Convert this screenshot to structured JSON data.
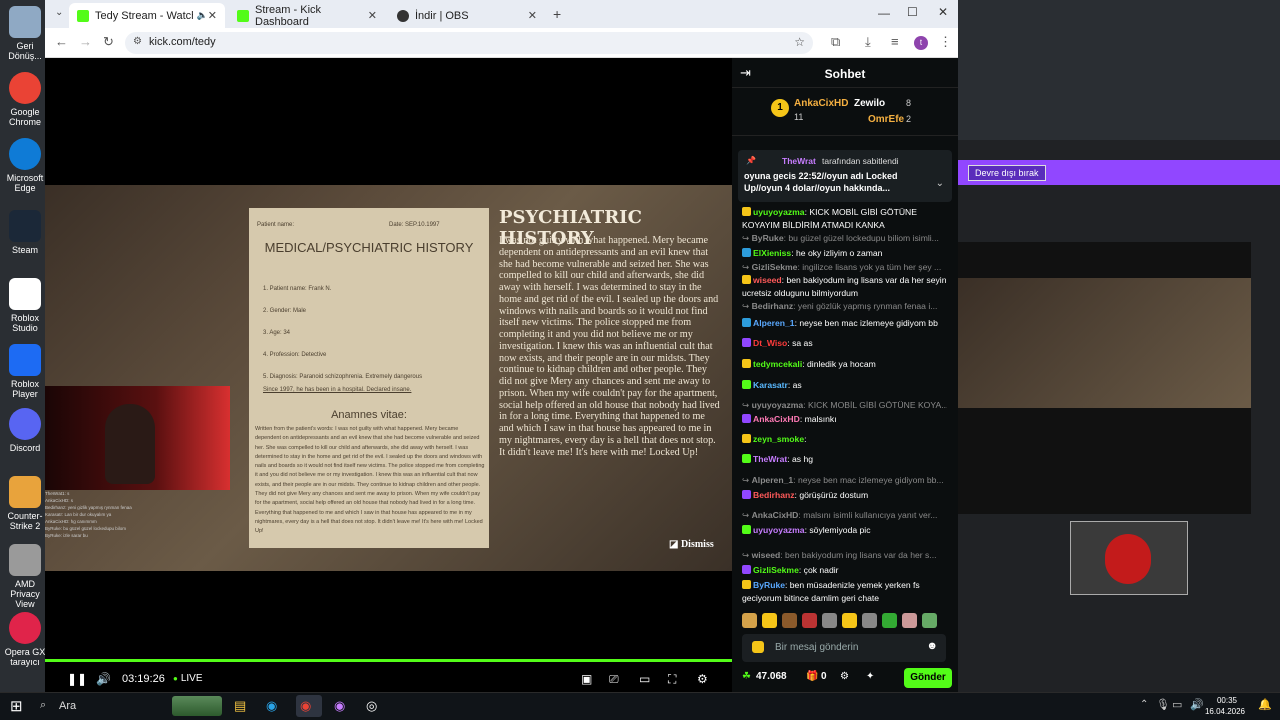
{
  "desktop": {
    "icons": [
      {
        "label": "Geri Dönüş...",
        "icon": "recycle-bin-icon"
      },
      {
        "label": "Google Chrome",
        "icon": "chrome-icon"
      },
      {
        "label": "Microsoft Edge",
        "icon": "edge-icon"
      },
      {
        "label": "Steam",
        "icon": "steam-icon"
      },
      {
        "label": "Roblox Studio",
        "icon": "roblox-studio-icon"
      },
      {
        "label": "Roblox Player",
        "icon": "roblox-player-icon"
      },
      {
        "label": "Discord",
        "icon": "discord-icon"
      },
      {
        "label": "Counter-Strike 2",
        "icon": "cs2-icon"
      },
      {
        "label": "AMD Privacy View",
        "icon": "amd-icon"
      },
      {
        "label": "Opera GX tarayıcı",
        "icon": "opera-gx-icon"
      }
    ]
  },
  "browser": {
    "tabs": [
      {
        "title": "Tedy Stream - Watch Live o",
        "favicon": "kick-icon"
      },
      {
        "title": "Stream - Kick Dashboard",
        "favicon": "kick-icon"
      },
      {
        "title": "İndir | OBS",
        "favicon": "obs-icon"
      }
    ],
    "url": "kick.com/tedy",
    "profile_initial": "t"
  },
  "game": {
    "paper": {
      "patient_name_label": "Patient name:",
      "date": "Date: SEP.10.1997",
      "title": "MEDICAL/PSYCHIATRIC HISTORY",
      "fields": [
        "1. Patient name: Frank N.",
        "2. Gender: Male",
        "3. Age: 34",
        "4. Profession: Detective",
        "5. Diagnosis: Paranoid schizophrenia.  Extremely dangerous"
      ],
      "since": "Since 1997, he has been in a hospital. Declared insane.",
      "anamnes": "Anamnes vitae:",
      "written": "Written from the patient's words: I was not guilty with what happened. Mery became dependent on antidepressants and an evil knew that she had become vulnerable and seized her. She was compelled to kill our child and afterwards, she did away with herself. I was determined to stay in the home and get rid of the evil. I sealed up the doors and windows with nails and boards so it would not find itself new victims. The police stopped me from completing it and you did not believe me or my investigation. I knew this was an influential cult that now exists, and their people are in our midsts. They continue to kidnap children and other people. They did not give Mery any chances and sent me away to prison. When my wife couldn't pay for the apartment, social help offered an old house that nobody had lived in for a long time. Everything that happened to me and which I saw in that house has appeared to me in my nightmares, every day is a hell that does not stop. It didn't leave me! It's here with me! Locked Up!"
    },
    "heading": "PSYCHIATRIC HISTORY",
    "text": "I was not guilty with what happened. Mery became dependent on antidepressants and an evil knew that she had become vulnerable and seized her. She was compelled to kill our child and afterwards, she did away with herself. I was determined to stay in the home and get rid of the evil. I sealed up the doors and windows with nails and boards so it would not find itself new victims. The police stopped me from completing it and you did not believe me or my investigation. I knew this was an influential cult that now exists, and their people are in our midsts. They continue to kidnap children and other people. They did not give Mery any chances and sent me away to prison. When my wife couldn't pay for the apartment, social help offered an old house that nobody had lived in for a long time. Everything that happened to me and which I saw in that house has appeared to me in my nightmares, every day is a hell that does not stop. It didn't leave me! It's here with me! Locked Up!",
    "dismiss": "Dismiss",
    "overlay_chat": [
      "TheWrat1: s",
      "AnkaCixHD: s",
      "Bedirhanz: yeni gizlik yapmış rynman fenaa",
      "Karasatr: Lan bir dur okuyalım ya",
      "AnkaCixHD: hg canımmm",
      "ByRuke: bu güzel güzel lockedupu bilom",
      "ByRuke: izle sarar bu"
    ]
  },
  "player": {
    "progress": 1.0,
    "time": "03:19:26",
    "live": "LIVE"
  },
  "chat": {
    "title": "Sohbet",
    "leaderboard": [
      {
        "rank": "1",
        "name": "AnkaCixHD",
        "count": "11",
        "color": "#f5b041"
      },
      {
        "name": "Zewilo",
        "count": "8",
        "color": "#ffffff"
      },
      {
        "name": "OmrEfe",
        "count": "2",
        "color": "#f5b041"
      }
    ],
    "pinned": {
      "by_user": "TheWrat",
      "by_suffix": "tarafından sabitlendi",
      "text": "oyuna gecis 22:52//oyun adı Locked Up//oyun 4 dolar//oyun hakkında..."
    },
    "messages": [
      {
        "user": "uyuyoyazma",
        "text": "KICK MOBİL GİBİ GÖTÜNE KOYAYIM BİLDİRİM ATMADI KANKA",
        "color": "#53fc18",
        "reply": false
      },
      {
        "user": "ByRuke",
        "text": "bu güzel güzel lockedupu biliom isimli...",
        "color": "#8a8a8a",
        "reply": true
      },
      {
        "user": "ElXieniss",
        "text": "he oky izliyim o zaman",
        "color": "#53fc18",
        "reply": false
      },
      {
        "user": "GizliSekme",
        "text": "ingilizce lisans yok ya tüm her şey ...",
        "color": "#8a8a8a",
        "reply": true
      },
      {
        "user": "wiseed",
        "text": "ben bakiyodum ing lisans var da her seyin ucretsiz oldugunu bilmiyordum",
        "color": "#ff5a5a",
        "reply": false
      },
      {
        "user": "Bedirhanz",
        "text": "yeni gözlük yapmış rynman fenaa i...",
        "color": "#8a8a8a",
        "reply": true
      },
      {
        "user": "Alperen_1",
        "text": "neyse ben mac izlemeye gidiyom bb",
        "color": "#5aa9ff",
        "reply": false
      },
      {
        "user": "Dt_Wiso",
        "text": "sa as",
        "color": "#ff3b3b",
        "reply": false
      },
      {
        "user": "tedymcekali",
        "text": "dinledik ya hocam",
        "color": "#53fc18",
        "reply": false
      },
      {
        "user": "Karasatr",
        "text": "as",
        "color": "#5ab9ff",
        "reply": false
      },
      {
        "user": "uyuyoyazma",
        "text": "KICK MOBİL GİBİ GÖTÜNE KOYA...",
        "color": "#8a8a8a",
        "reply": true
      },
      {
        "user": "AnkaCixHD",
        "text": "malsınkı",
        "color": "#ff7ab6",
        "reply": false
      },
      {
        "user": "zeyn_smoke",
        "text": "",
        "color": "#53fc18",
        "reply": false
      },
      {
        "user": "TheWrat",
        "text": "as hg",
        "color": "#c77dff",
        "reply": false
      },
      {
        "user": "Alperen_1",
        "text": "neyse ben mac izlemeye gidiyom bb...",
        "color": "#8a8a8a",
        "reply": true
      },
      {
        "user": "Bedirhanz",
        "text": "görüşürüz dostum",
        "color": "#ff5a5a",
        "reply": false
      },
      {
        "user": "AnkaCixHD",
        "text": "malsını isimli kullanıcıya yanıt ver...",
        "color": "#8a8a8a",
        "reply": true
      },
      {
        "user": "uyuyoyazma",
        "text": "söylemiyoda pic",
        "color": "#c77dff",
        "reply": false
      },
      {
        "user": "wiseed",
        "text": "ben bakiyodum ing lisans var da her s...",
        "color": "#8a8a8a",
        "reply": true
      },
      {
        "user": "GizliSekme",
        "text": "çok nadir",
        "color": "#53fc18",
        "reply": false
      },
      {
        "user": "ByRuke",
        "text": "ben müsadenizle yemek yerken fs geciyorum bitince damlim geri chate",
        "color": "#5aa9ff",
        "reply": false
      }
    ],
    "input_placeholder": "Bir mesaj gönderin",
    "viewers": "47.068",
    "gifts": "0",
    "send_label": "Gönder"
  },
  "obs": {
    "disable_label": "Devre dışı bırak"
  },
  "taskbar": {
    "search_placeholder": "Ara",
    "time": "00:35",
    "date": "16.04.2026"
  },
  "colors": {
    "kick_green": "#53fc18",
    "obs_purple": "#9147ff"
  }
}
